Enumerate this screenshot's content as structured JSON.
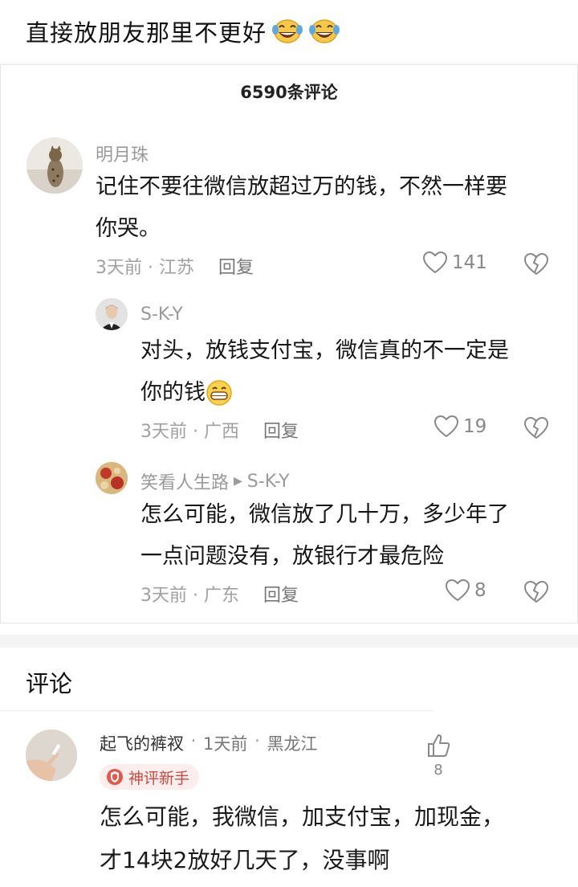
{
  "post": {
    "title": "直接放朋友那里不更好",
    "emoji": [
      "laughing-tears-emoji",
      "laughing-tears-emoji"
    ]
  },
  "embedded": {
    "header": "6590条评论",
    "comments": [
      {
        "name": "明月珠",
        "text_line1": "记住不要往微信放超过万的钱，不然一样要",
        "text_line2": "你哭。",
        "time": "3天前",
        "location": "江苏",
        "reply": "回复",
        "likes": "141"
      },
      {
        "name": "S-K-Y",
        "text_line1": "对头，放钱支付宝，微信真的不一定是",
        "text_line2": "你的钱",
        "emoji": "grinning-face-emoji",
        "time": "3天前",
        "location": "广西",
        "reply": "回复",
        "likes": "19"
      },
      {
        "name": "笑看人生路",
        "reply_to": "S-K-Y",
        "text_line1": "怎么可能，微信放了几十万，多少年了",
        "text_line2": "一点问题没有，放银行才最危险",
        "time": "3天前",
        "location": "广东",
        "reply": "回复",
        "likes": "8"
      }
    ]
  },
  "comments_section": {
    "title": "评论",
    "items": [
      {
        "name": "起飞的裤衩",
        "time": "1天前",
        "location": "黑龙江",
        "badge": "神评新手",
        "text_line1": "怎么可能，我微信，加支付宝，加现金，",
        "text_line2": "才14块2放好几天了，没事啊",
        "likes": "8"
      }
    ]
  },
  "colors": {
    "accent": "#c9493e",
    "muted": "#a0a0a0"
  }
}
